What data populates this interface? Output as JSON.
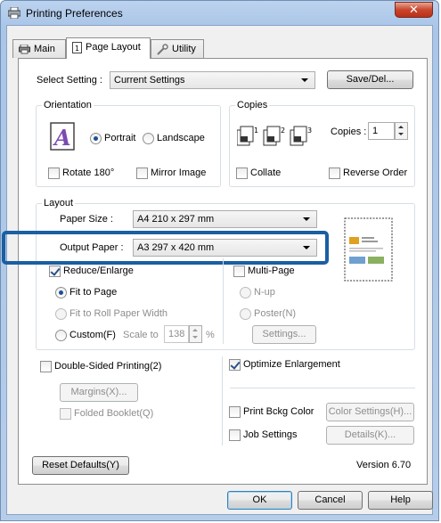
{
  "window": {
    "title": "Printing Preferences",
    "close": "✕"
  },
  "tabs": [
    {
      "label": "Main"
    },
    {
      "label": "Page Layout"
    },
    {
      "label": "Utility"
    }
  ],
  "select_setting": {
    "label": "Select Setting :",
    "value": "Current Settings",
    "save_label": "Save/Del..."
  },
  "orientation": {
    "title": "Orientation",
    "portrait": "Portrait",
    "landscape": "Landscape",
    "selected": "Portrait",
    "rotate": "Rotate 180°",
    "mirror": "Mirror Image"
  },
  "copies": {
    "title": "Copies",
    "label": "Copies :",
    "value": "1",
    "collate": "Collate",
    "reverse": "Reverse Order"
  },
  "layout": {
    "title": "Layout",
    "paper_size_label": "Paper Size :",
    "paper_size": "A4 210 x 297 mm",
    "output_paper_label": "Output Paper :",
    "output_paper": "A3 297 x 420 mm",
    "reduce_enlarge": "Reduce/Enlarge",
    "fit_to_page": "Fit to Page",
    "fit_roll": "Fit to Roll Paper Width",
    "custom": "Custom(F)",
    "scale_to": "Scale to",
    "scale_value": "138",
    "percent": "%",
    "multi_page": "Multi-Page",
    "nup": "N-up",
    "poster": "Poster(N)",
    "settings": "Settings..."
  },
  "double_sided": {
    "label": "Double-Sided Printing(2)",
    "margins": "Margins(X)...",
    "folded": "Folded Booklet(Q)"
  },
  "optimize": "Optimize Enlargement",
  "print_bckg": {
    "label": "Print Bckg Color",
    "button": "Color Settings(H)..."
  },
  "job": {
    "label": "Job Settings",
    "button": "Details(K)..."
  },
  "reset": "Reset Defaults(Y)",
  "version": "Version 6.70",
  "footer": {
    "ok": "OK",
    "cancel": "Cancel",
    "help": "Help"
  },
  "colors": {
    "highlight": "#1b5ea2",
    "title_bg": "#bcd3ee",
    "close": "#c9462c"
  }
}
